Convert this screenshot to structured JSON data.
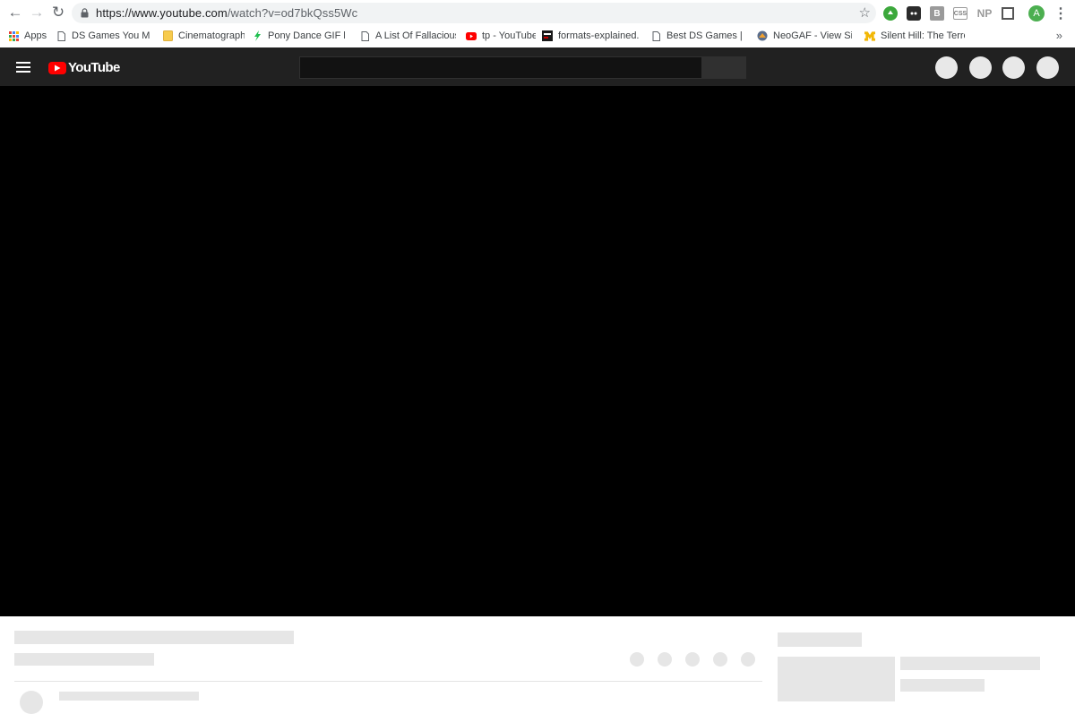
{
  "browser": {
    "url_prefix": "https://www.youtube.com",
    "url_path": "/watch?v=od7bkQss5Wc",
    "nav": {
      "back": "←",
      "forward": "→",
      "reload": "↻"
    },
    "star": "☆",
    "extensions": [
      "green-extension",
      "dark-extension",
      "B",
      "CSS",
      "NP",
      "square-extension"
    ],
    "profile_initial": "A",
    "menu": "⋮",
    "accent": "#3ca83c"
  },
  "bookmarks": {
    "items": [
      {
        "label": "Apps",
        "icon": "apps-grid-icon"
      },
      {
        "label": "DS Games You Might",
        "icon": "page-icon"
      },
      {
        "label": "Cinematography",
        "icon": "folder-icon"
      },
      {
        "label": "Pony Dance GIF by -",
        "icon": "giphy-icon"
      },
      {
        "label": "A List Of Fallacious A",
        "icon": "page-icon"
      },
      {
        "label": "tp - YouTube",
        "icon": "youtube-icon"
      },
      {
        "label": "formats-explained.ht",
        "icon": "formats-icon"
      },
      {
        "label": "Best DS Games | Gam",
        "icon": "page-icon"
      },
      {
        "label": "NeoGAF - View Singl",
        "icon": "neogaf-icon"
      },
      {
        "label": "Silent Hill: The Terror",
        "icon": "m-logo-icon"
      }
    ],
    "more": "»"
  },
  "youtube": {
    "logo_text": "YouTube",
    "brand_red": "#ff0000",
    "header_bg": "#212121",
    "player_bg": "#000000"
  }
}
